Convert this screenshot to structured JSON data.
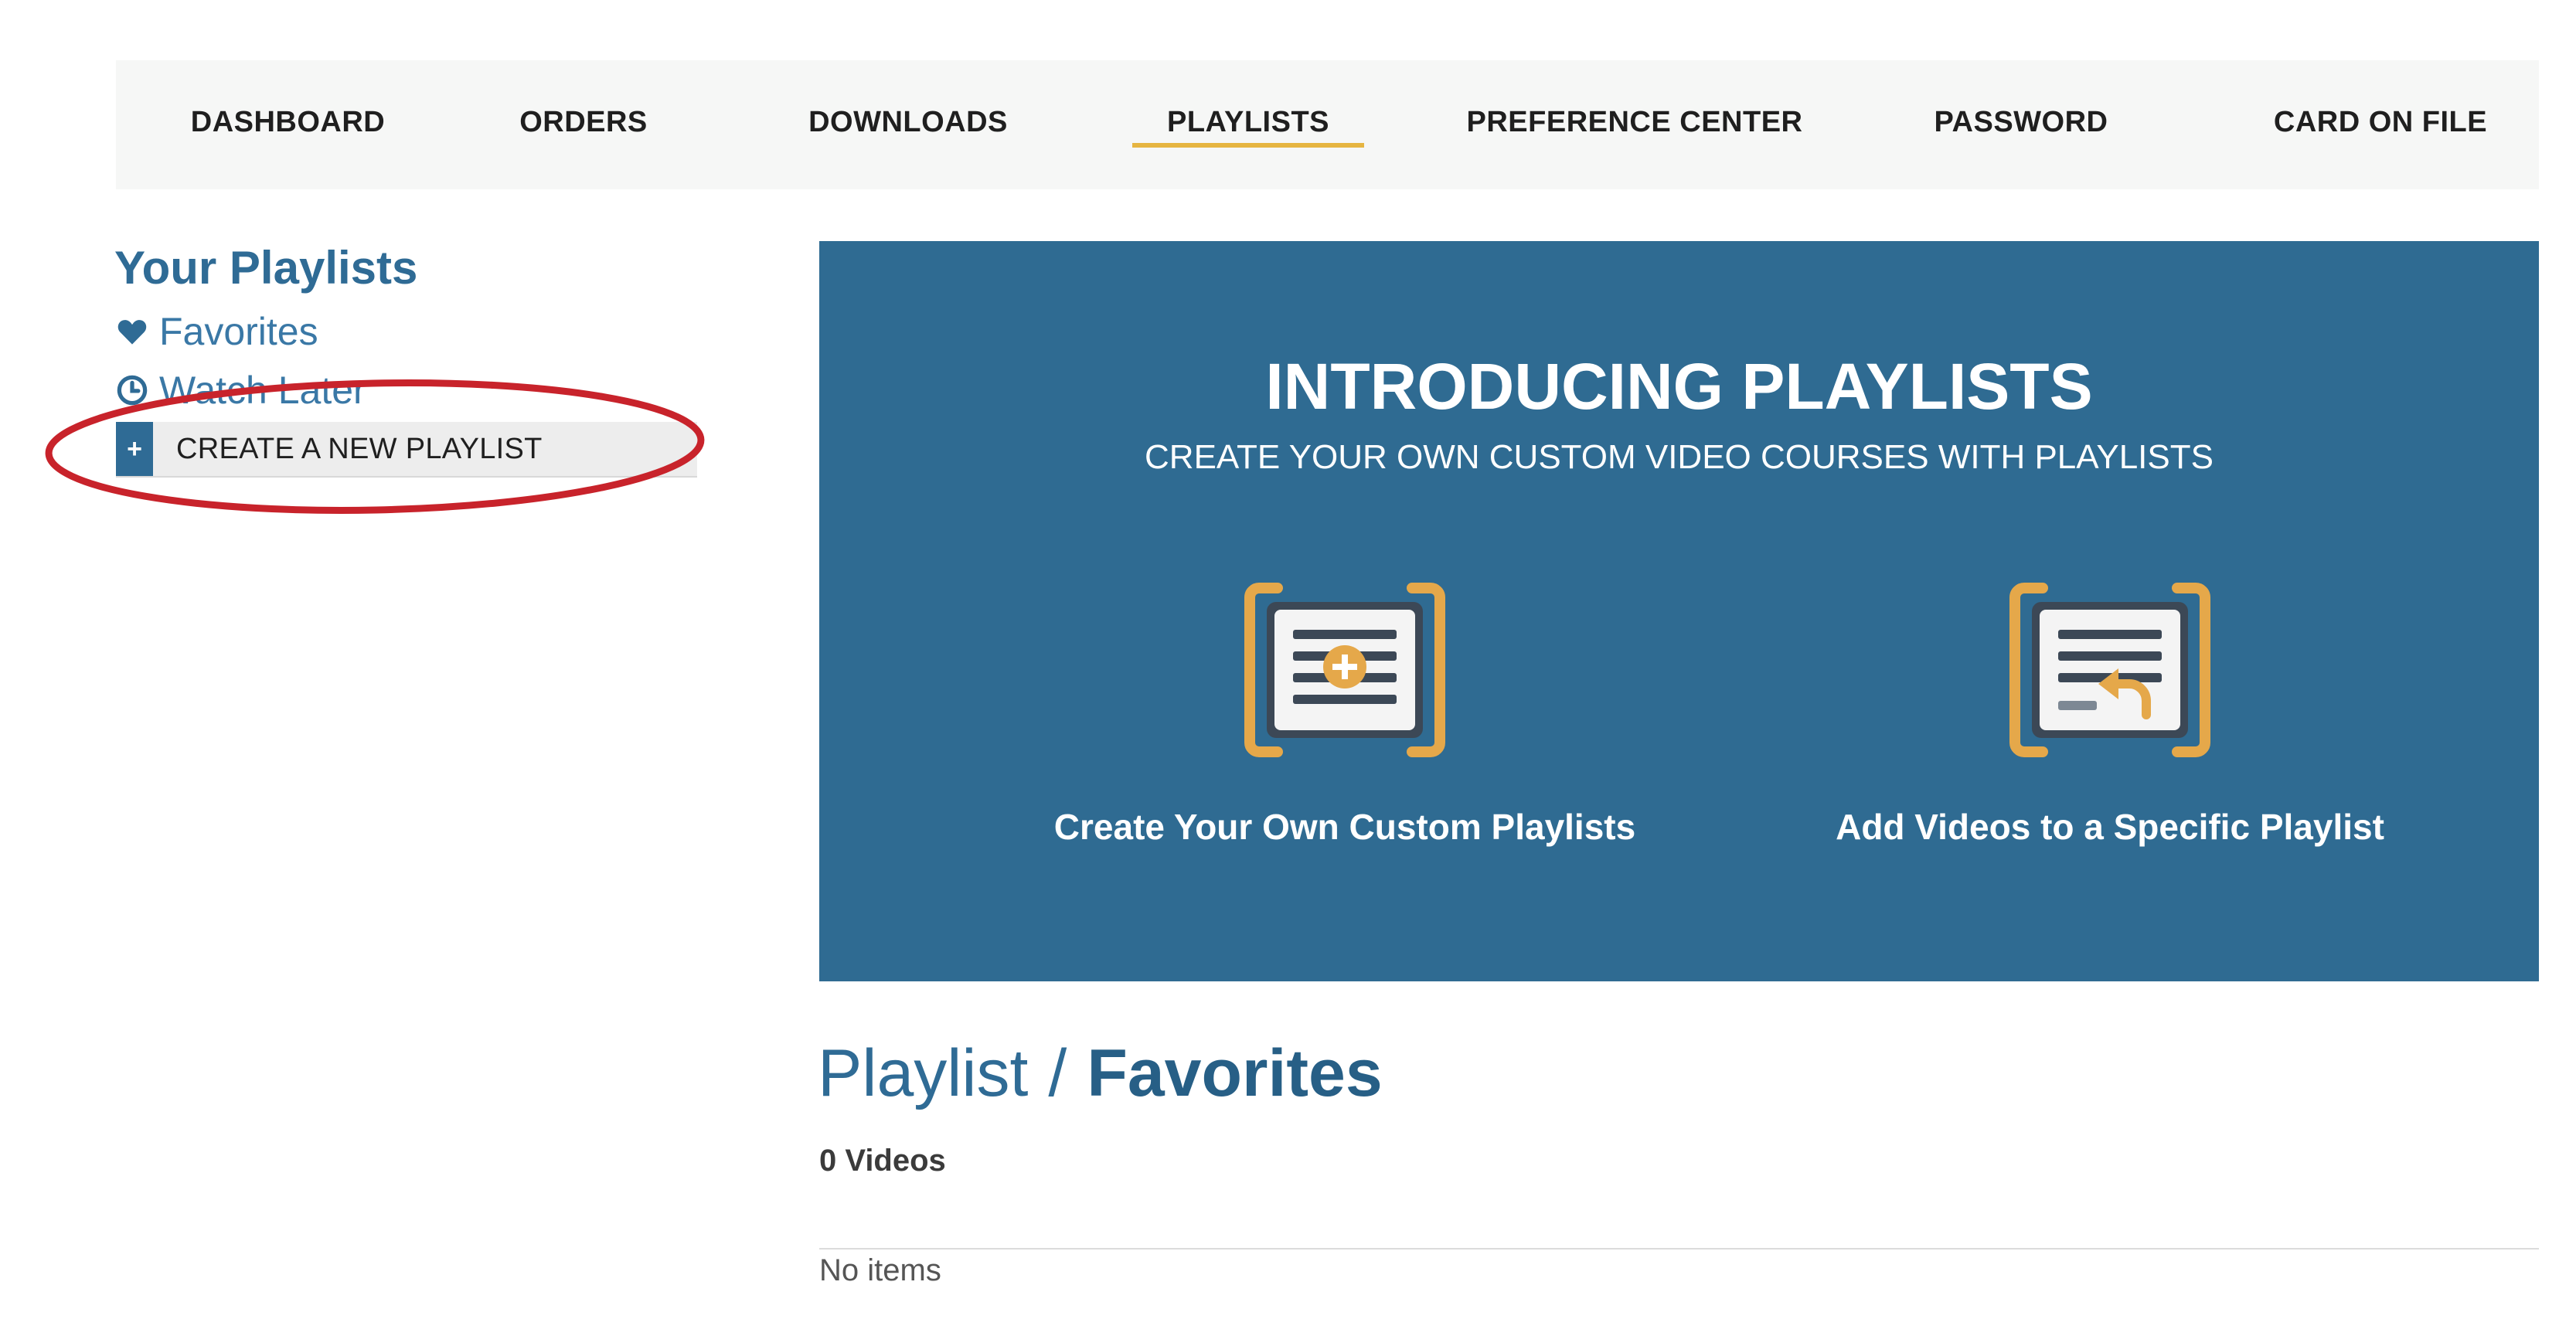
{
  "nav": {
    "items": [
      {
        "label": "DASHBOARD"
      },
      {
        "label": "ORDERS"
      },
      {
        "label": "DOWNLOADS"
      },
      {
        "label": "PLAYLISTS",
        "active": true
      },
      {
        "label": "PREFERENCE CENTER"
      },
      {
        "label": "PASSWORD"
      },
      {
        "label": "CARD ON FILE"
      }
    ],
    "active_underline_color": "#e6b541"
  },
  "sidebar": {
    "title": "Your Playlists",
    "links": [
      {
        "label": "Favorites",
        "icon": "heart-icon"
      },
      {
        "label": "Watch Later",
        "icon": "clock-icon"
      }
    ],
    "create_button": {
      "icon": "plus-icon",
      "icon_text": "+",
      "label": "CREATE A NEW PLAYLIST"
    },
    "annotation_color": "#c8232b"
  },
  "banner": {
    "title": "INTRODUCING PLAYLISTS",
    "subtitle": "CREATE YOUR OWN CUSTOM VIDEO COURSES WITH PLAYLISTS",
    "background_color": "#2f6b92",
    "features": [
      {
        "label": "Create Your Own Custom Playlists",
        "icon": "playlist-add-icon"
      },
      {
        "label": "Add Videos to a Specific Playlist",
        "icon": "playlist-insert-icon"
      }
    ],
    "icon_bracket_color": "#e5a84a"
  },
  "playlist": {
    "prefix": "Playlist",
    "separator": "/",
    "name": "Favorites",
    "count_label": "0 Videos",
    "empty_message": "No items"
  }
}
